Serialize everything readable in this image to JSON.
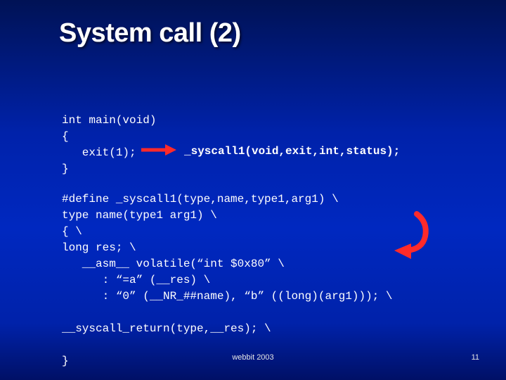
{
  "title": "System call (2)",
  "code1": "int main(void)\n{\n   exit(1);\n}",
  "syscall_annotation": "_syscall1(void,exit,int,status);",
  "code2": "#define _syscall1(type,name,type1,arg1) \\\ntype name(type1 arg1) \\\n{ \\ \nlong res; \\\n   __asm__ volatile(“int $0x80” \\\n      : “=a” (__res) \\\n      : “0” (__NR_##name), “b” ((long)(arg1))); \\\n\n__syscall_return(type,__res); \\\n\n}",
  "footer": "webbit 2003",
  "page": "11"
}
